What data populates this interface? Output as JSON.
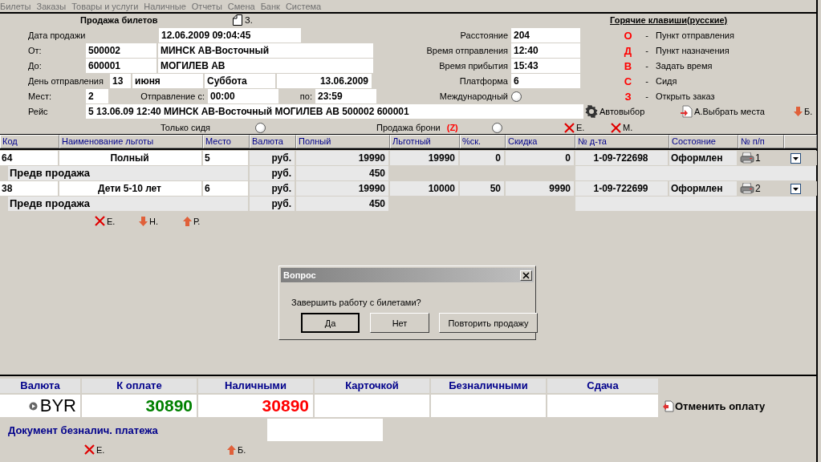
{
  "menu": [
    "Билеты",
    "Заказы",
    "Товары и услуги",
    "Наличные",
    "Отчеты",
    "Смена",
    "Банк",
    "Система"
  ],
  "form": {
    "title": "Продажа билетов",
    "doc_button": "З.",
    "sale_date": {
      "label": "Дата продажи",
      "value": "12.06.2009 09:04:45"
    },
    "from": {
      "label": "От:",
      "code": "500002",
      "name": "МИНСК АВ-Восточный"
    },
    "to": {
      "label": "До:",
      "code": "600001",
      "name": "МОГИЛЕВ АВ"
    },
    "departure_day": {
      "label": "День отправления",
      "day": "13",
      "month": "июня",
      "weekday": "Суббота",
      "date": "13.06.2009"
    },
    "seats": {
      "label": "Мест:",
      "value": "2",
      "from_label": "Отправление с:",
      "from_time": "00:00",
      "to_label": "по:",
      "to_time": "23:59"
    },
    "trip": {
      "label": "Рейс",
      "value": "5 13.06.09 12:40 МИНСК АВ-Восточный МОГИЛЕВ АВ 500002 600001"
    },
    "info": [
      {
        "label": "Расстояние",
        "value": "204"
      },
      {
        "label": "Время отправления",
        "value": "12:40"
      },
      {
        "label": "Время прибытия",
        "value": "15:43"
      },
      {
        "label": "Платформа",
        "value": "6"
      }
    ],
    "international": {
      "label": "Международный",
      "on": false
    },
    "actions": [
      {
        "kind": "gear",
        "label": "Автовыбор"
      },
      {
        "kind": "seat",
        "label": "А.Выбрать места"
      },
      {
        "kind": "down",
        "label": "Б."
      }
    ],
    "seated_only": {
      "label": "Только сидя",
      "on": false
    },
    "reservation_sale": {
      "label": "Продажа брони",
      "key": "(Z)",
      "on": false
    },
    "row_actions": [
      {
        "kind": "cross",
        "label": "Е."
      },
      {
        "kind": "cross",
        "label": "М."
      }
    ]
  },
  "hotkeys": {
    "title": "Горячие клавиши(русские)",
    "items": [
      {
        "key": "О",
        "dash": "-",
        "action": "Пункт отправления"
      },
      {
        "key": "Д",
        "dash": "-",
        "action": "Пункт назначения"
      },
      {
        "key": "В",
        "dash": "-",
        "action": "Задать время"
      },
      {
        "key": "С",
        "dash": "-",
        "action": "Сидя"
      },
      {
        "key": "З",
        "dash": "-",
        "action": "Открыть заказ"
      }
    ]
  },
  "table": {
    "columns": [
      "Код",
      "Наименование льготы",
      "Место",
      "Валюта",
      "Полный",
      "Льготный",
      "%ск.",
      "Скидка",
      "№ д-та",
      "Состояние",
      "№ п/п"
    ],
    "rows": [
      {
        "cells": [
          "64",
          "Полный",
          "5",
          "руб.",
          "19990",
          "19990",
          "0",
          "0",
          "1-09-722698",
          "Оформлен",
          "1"
        ],
        "fee": {
          "label": "Предв продажа",
          "currency": "руб.",
          "amount": "450"
        }
      },
      {
        "cells": [
          "38",
          "Дети 5-10 лет",
          "6",
          "руб.",
          "19990",
          "10000",
          "50",
          "9990",
          "1-09-722699",
          "Оформлен",
          "2"
        ],
        "fee": {
          "label": "Предв продажа",
          "currency": "руб.",
          "amount": "450"
        }
      }
    ]
  },
  "table_actions": [
    {
      "kind": "cross",
      "label": "Е."
    },
    {
      "kind": "down",
      "label": "Н."
    },
    {
      "kind": "up",
      "label": "Р."
    }
  ],
  "dialog": {
    "title": "Вопрос",
    "message": "Завершить работу с билетами?",
    "buttons": [
      {
        "label": "Да",
        "selected": true
      },
      {
        "label": "Нет",
        "selected": false
      },
      {
        "label": "Повторить продажу",
        "selected": false
      }
    ]
  },
  "payment": {
    "columns": [
      "Валюта",
      "К оплате",
      "Наличными",
      "Карточкой",
      "Безналичными",
      "Сдача"
    ],
    "currency": "BYR",
    "to_pay": "30890",
    "cash": "30890",
    "cancel": "Отменить оплату",
    "document_label": "Документ безналич. платежа",
    "actions": [
      {
        "kind": "cross",
        "label": "Е."
      },
      {
        "kind": "up",
        "label": "Б."
      }
    ]
  }
}
